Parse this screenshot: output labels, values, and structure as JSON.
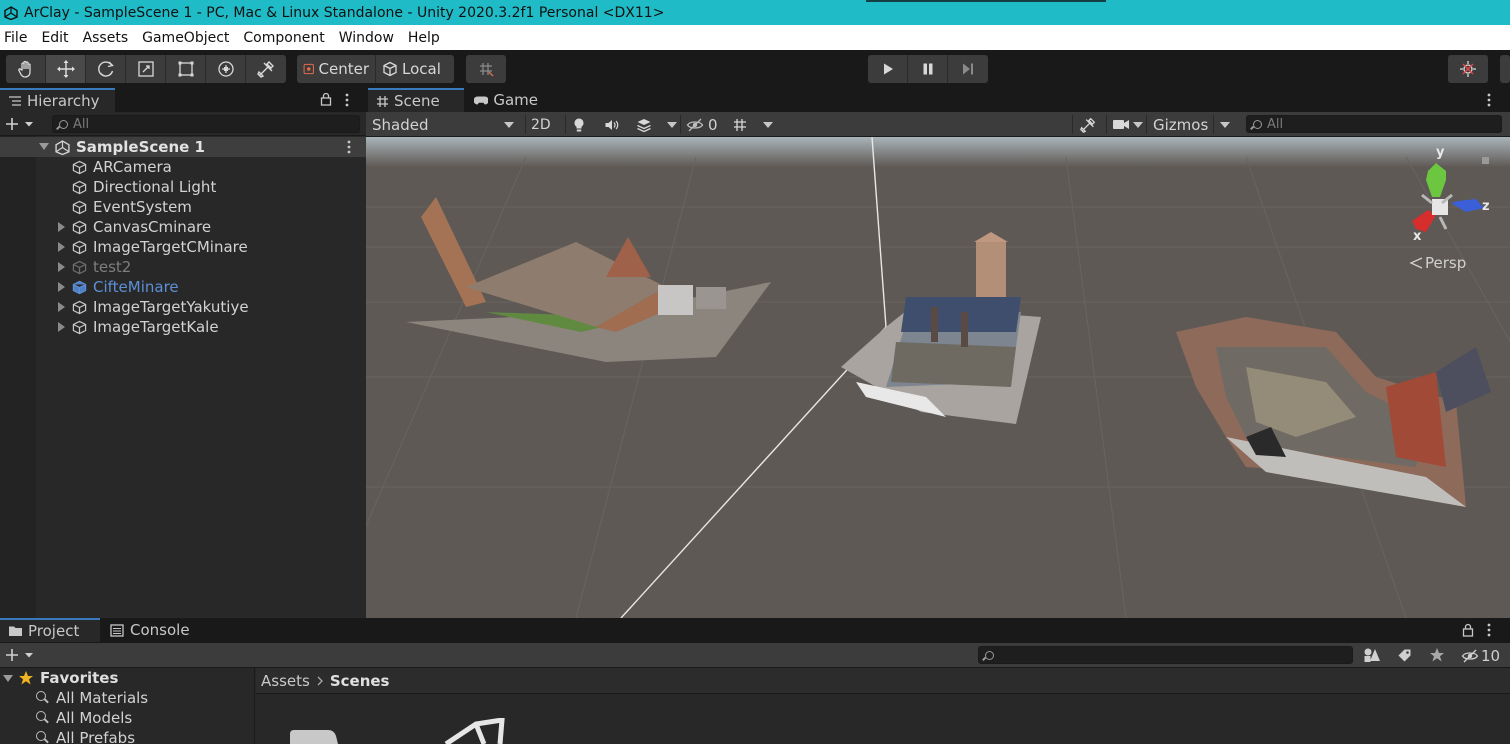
{
  "window": {
    "title": "ArClay - SampleScene 1 - PC, Mac & Linux Standalone - Unity 2020.3.2f1 Personal <DX11>"
  },
  "menu": [
    "File",
    "Edit",
    "Assets",
    "GameObject",
    "Component",
    "Window",
    "Help"
  ],
  "toolbar": {
    "tools": [
      "hand-tool",
      "move-tool",
      "rotate-tool",
      "scale-tool",
      "rect-tool",
      "transform-tool",
      "custom-tool"
    ],
    "active_tool": "move-tool",
    "pivot_label": "Center",
    "space_label": "Local"
  },
  "hierarchy": {
    "tab_label": "Hierarchy",
    "search_placeholder": "All",
    "scene_name": "SampleScene 1",
    "items": [
      {
        "label": "ARCamera",
        "expandable": false,
        "state": "normal"
      },
      {
        "label": "Directional Light",
        "expandable": false,
        "state": "normal"
      },
      {
        "label": "EventSystem",
        "expandable": false,
        "state": "normal"
      },
      {
        "label": "CanvasCminare",
        "expandable": true,
        "state": "normal"
      },
      {
        "label": "ImageTargetCMinare",
        "expandable": true,
        "state": "normal"
      },
      {
        "label": "test2",
        "expandable": true,
        "state": "disabled"
      },
      {
        "label": "CifteMinare",
        "expandable": true,
        "state": "prefab"
      },
      {
        "label": "ImageTargetYakutiye",
        "expandable": true,
        "state": "normal"
      },
      {
        "label": "ImageTargetKale",
        "expandable": true,
        "state": "normal"
      }
    ]
  },
  "scene": {
    "tabs": [
      "Scene",
      "Game"
    ],
    "active_tab": "Scene",
    "shading_mode": "Shaded",
    "mode_2d": "2D",
    "hidden_count": "0",
    "gizmos_label": "Gizmos",
    "search_placeholder": "All",
    "projection_label": "Persp",
    "axis_labels": {
      "x": "x",
      "y": "y",
      "z": "z"
    },
    "colors": {
      "x_axis": "#d62d2d",
      "y_axis": "#5fc03a",
      "z_axis": "#3a5fd8",
      "ground": "#5f5955"
    }
  },
  "project": {
    "tabs": [
      "Project",
      "Console"
    ],
    "active_tab": "Project",
    "hidden_count": "10",
    "favorites_label": "Favorites",
    "favorites": [
      "All Materials",
      "All Models",
      "All Prefabs"
    ],
    "breadcrumb": [
      "Assets",
      "Scenes"
    ]
  }
}
